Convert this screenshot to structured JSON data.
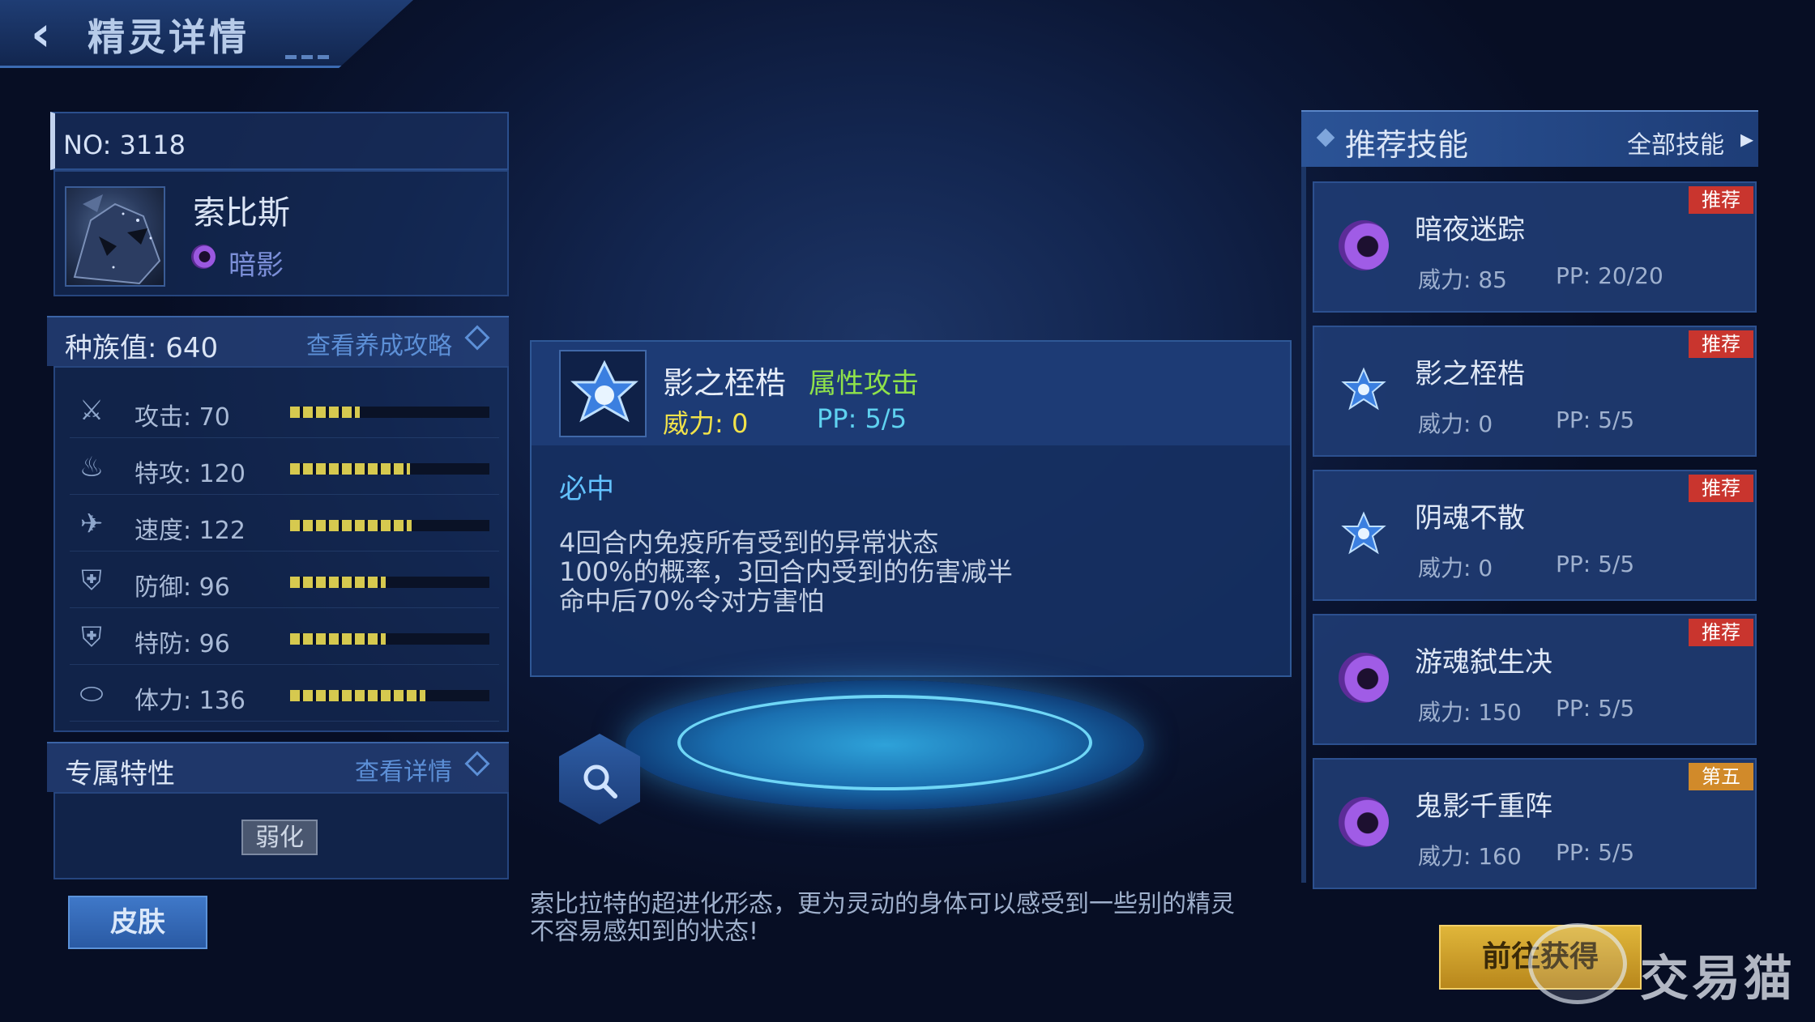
{
  "header": {
    "title": "精灵详情"
  },
  "pet": {
    "no_label": "NO: 3118",
    "name": "索比斯",
    "type_name": "暗影"
  },
  "race": {
    "label": "种族值: 640",
    "guide_link": "查看养成攻略"
  },
  "stats": [
    {
      "label": "攻击: 70",
      "icon": "sword-icon",
      "value": 70
    },
    {
      "label": "特攻: 120",
      "icon": "energy-icon",
      "value": 120
    },
    {
      "label": "速度: 122",
      "icon": "boot-icon",
      "value": 122
    },
    {
      "label": "防御: 96",
      "icon": "shield-icon",
      "value": 96
    },
    {
      "label": "特防: 96",
      "icon": "special-shield-icon",
      "value": 96
    },
    {
      "label": "体力: 136",
      "icon": "capsule-icon",
      "value": 136
    }
  ],
  "trait": {
    "title": "专属特性",
    "detail_link": "查看详情",
    "badge": "弱化"
  },
  "skin_button": "皮肤",
  "selected_skill": {
    "name": "影之桎梏",
    "category": "属性攻击",
    "power": "威力: 0",
    "pp": "PP: 5/5",
    "hit": "必中",
    "desc": [
      "4回合内免疫所有受到的异常状态",
      "100%的概率，3回合内受到的伤害减半",
      "命中后70%令对方害怕"
    ]
  },
  "flavor_text": [
    "索比拉特的超进化形态，更为灵动的身体可以感受到一些别的精灵",
    "不容易感知到的状态!"
  ],
  "recommended": {
    "title": "推荐技能",
    "all_link": "全部技能",
    "skills": [
      {
        "name": "暗夜迷踪",
        "power": "威力: 85",
        "pp": "PP: 20/20",
        "tag": "推荐",
        "icon": "moon-icon"
      },
      {
        "name": "影之桎梏",
        "power": "威力: 0",
        "pp": "PP: 5/5",
        "tag": "推荐",
        "icon": "star-icon"
      },
      {
        "name": "阴魂不散",
        "power": "威力: 0",
        "pp": "PP: 5/5",
        "tag": "推荐",
        "icon": "star-icon"
      },
      {
        "name": "游魂弑生决",
        "power": "威力: 150",
        "pp": "PP: 5/5",
        "tag": "推荐",
        "icon": "moon-icon"
      },
      {
        "name": "鬼影千重阵",
        "power": "威力: 160",
        "pp": "PP: 5/5",
        "tag": "第五",
        "icon": "moon-icon"
      }
    ]
  },
  "goto_button": "前往获得",
  "watermark": "交易猫",
  "colors": {
    "accent": "#5c8fd6",
    "stat_fill": "#d6c94f",
    "tag_red": "#c9352e",
    "tag_orange": "#d18a2a",
    "category_green": "#8fe24a"
  }
}
